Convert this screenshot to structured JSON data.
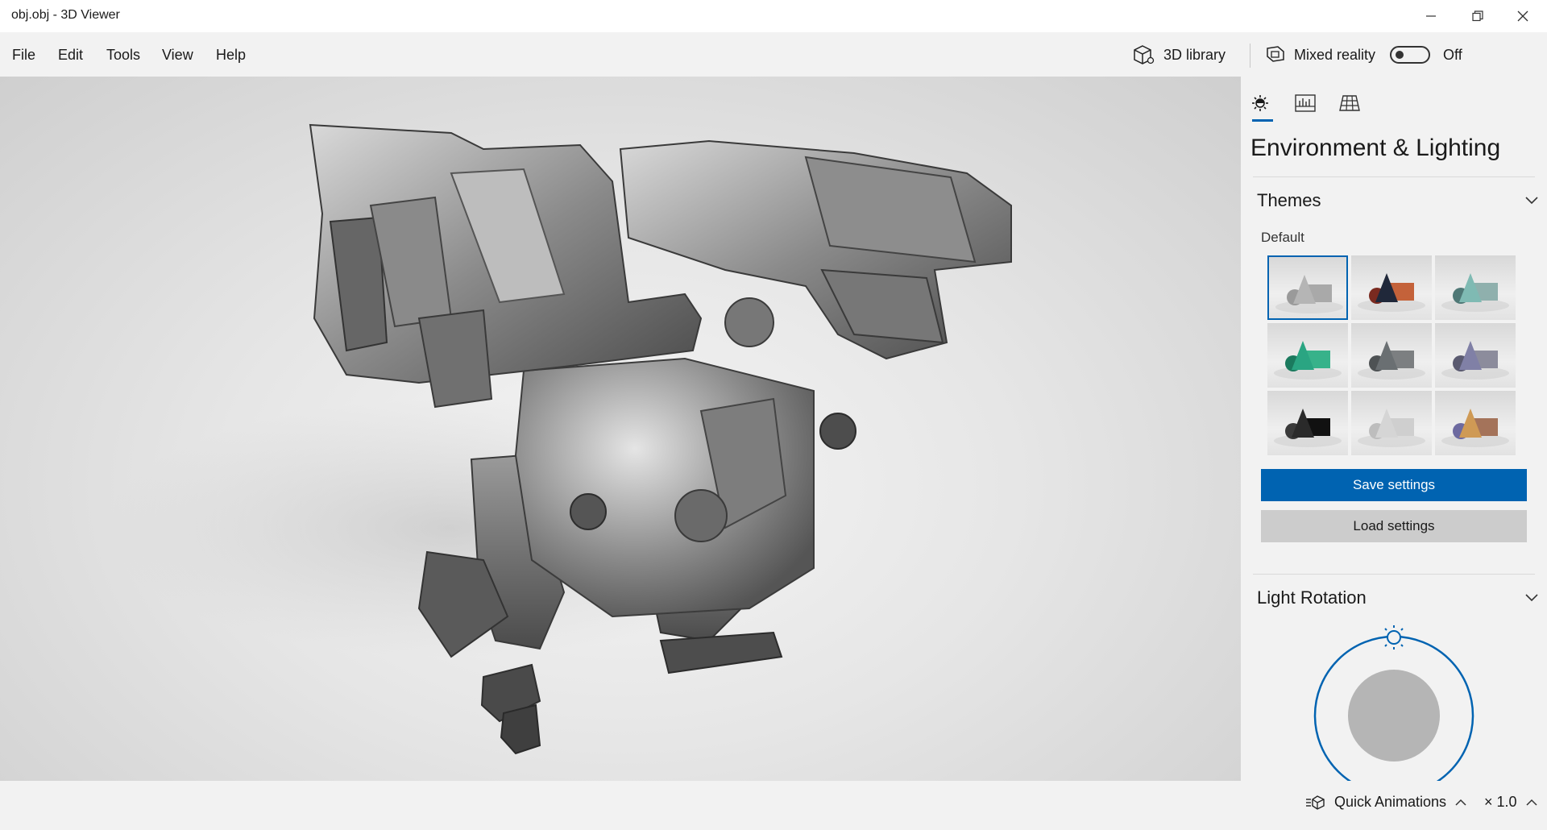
{
  "window": {
    "title": "obj.obj - 3D Viewer",
    "minimize_icon": "minimize-icon",
    "restore_icon": "restore-icon",
    "close_icon": "close-icon"
  },
  "menu": {
    "items": [
      "File",
      "Edit",
      "Tools",
      "View",
      "Help"
    ],
    "library_label": "3D library",
    "library_icon": "cube-icon",
    "mixed_reality_label": "Mixed reality",
    "mixed_reality_icon": "mixed-reality-icon",
    "mixed_reality_state": "Off"
  },
  "panel": {
    "tabs": [
      {
        "name": "environment-lighting-tab",
        "icon": "sun-icon",
        "active": true
      },
      {
        "name": "stats-tab",
        "icon": "stats-icon",
        "active": false
      },
      {
        "name": "grid-tab",
        "icon": "grid-icon",
        "active": false
      }
    ],
    "title": "Environment & Lighting",
    "themes": {
      "header": "Themes",
      "selected_label": "Default",
      "selected_index": 0,
      "items": [
        {
          "name": "default",
          "cone": "#b5b5b5",
          "box": "#a9a9a9",
          "sphere": "#9a9a9a"
        },
        {
          "name": "sunset",
          "cone": "#20283a",
          "box": "#c4623a",
          "sphere": "#7a2a20"
        },
        {
          "name": "teal",
          "cone": "#7fbab3",
          "box": "#8fb0ad",
          "sphere": "#4f7876"
        },
        {
          "name": "green",
          "cone": "#2aa582",
          "box": "#37b28a",
          "sphere": "#1b7a5e"
        },
        {
          "name": "slate",
          "cone": "#6a6f72",
          "box": "#7c7f81",
          "sphere": "#4e5254"
        },
        {
          "name": "violet",
          "cone": "#8080a6",
          "box": "#8c8c9c",
          "sphere": "#5a5a70"
        },
        {
          "name": "dark",
          "cone": "#2a2a2a",
          "box": "#111111",
          "sphere": "#3a3a3a"
        },
        {
          "name": "light",
          "cone": "#d5d5d5",
          "box": "#cfcfcf",
          "sphere": "#bdbdbd"
        },
        {
          "name": "warm",
          "cone": "#cf9a55",
          "box": "#a4735a",
          "sphere": "#6d6aa0"
        }
      ]
    },
    "save_settings": "Save settings",
    "load_settings": "Load settings",
    "light_rotation": {
      "header": "Light Rotation"
    }
  },
  "status": {
    "quick_animations": "Quick Animations",
    "speed": "× 1.0"
  },
  "colors": {
    "accent": "#0063b1",
    "panel_bg": "#f2f2f2",
    "secondary_button": "#cccccc"
  }
}
